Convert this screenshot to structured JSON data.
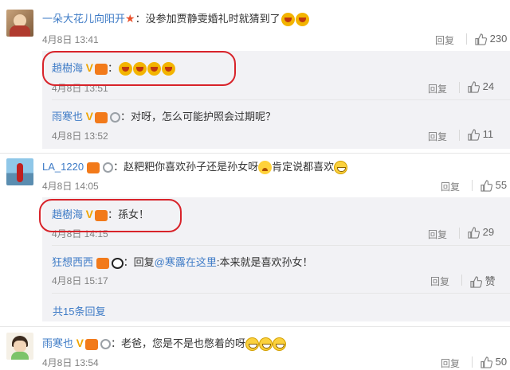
{
  "comments": [
    {
      "user": "一朵大花儿向阳开",
      "text": "：没参加贾静雯婚礼时就猜到了",
      "time": "4月8日 13:41",
      "reply_label": "回复",
      "likes": "230"
    },
    {
      "user": "LA_1220",
      "text": "：赵粑粑你喜欢孙子还是孙女呀",
      "text2": "肯定说都喜欢",
      "time": "4月8日 14:05",
      "reply_label": "回复",
      "likes": "55"
    },
    {
      "user": "雨寒也",
      "text": "：老爸，您是不是也憋着的呀",
      "time": "4月8日 13:54",
      "reply_label": "回复",
      "likes": "50"
    }
  ],
  "replies": [
    {
      "user": "趙樹海",
      "text": "：",
      "time": "4月8日 13:51",
      "reply_label": "回复",
      "likes": "24"
    },
    {
      "user": "雨寒也",
      "text": "：对呀，怎么可能护照会过期呢？",
      "time": "4月8日 13:52",
      "reply_label": "回复",
      "likes": "11"
    },
    {
      "user": "趙樹海",
      "text": "：孫女！",
      "time": "4月8日 14:15",
      "reply_label": "回复",
      "likes": "29"
    },
    {
      "user": "狂想西西",
      "text_prefix": "：回复",
      "mention": "@寒露在这里",
      "text": ":本来就是喜欢孙女！",
      "time": "4月8日 15:17",
      "reply_label": "回复",
      "likes": "赞"
    }
  ],
  "more_replies": "共15条回复",
  "colors": {
    "link": "#3e7bc6",
    "highlight": "#d8232a",
    "reply_bg": "#f2f2f5"
  }
}
